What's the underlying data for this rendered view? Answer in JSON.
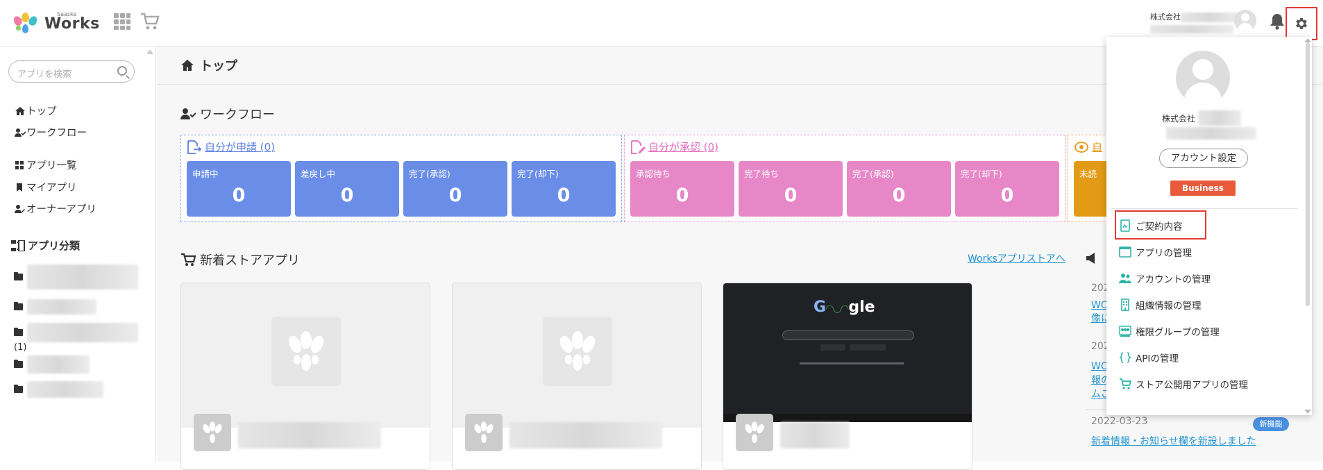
{
  "header": {
    "logo_small": "Saaske",
    "logo_text": "Works",
    "company_prefix": "株式会社"
  },
  "sidebar": {
    "search_placeholder": "アプリを検索",
    "nav": [
      {
        "label": "トップ",
        "icon": "home-icon"
      },
      {
        "label": "ワークフロー",
        "icon": "user-check-icon"
      },
      {
        "label": "アプリ一覧",
        "icon": "grid-icon"
      },
      {
        "label": "マイアプリ",
        "icon": "bookmark-icon"
      },
      {
        "label": "オーナーアプリ",
        "icon": "user-edit-icon"
      }
    ],
    "category_title": "アプリ分類",
    "category_count": "(1)"
  },
  "main": {
    "page_title": "トップ",
    "workflow_title": "ワークフロー",
    "groups": [
      {
        "link": "自分が申請 (0)",
        "color": "#6a8ee8",
        "cards": [
          {
            "label": "申請中",
            "value": "0"
          },
          {
            "label": "差戻し中",
            "value": "0"
          },
          {
            "label": "完了(承認)",
            "value": "0"
          },
          {
            "label": "完了(却下)",
            "value": "0"
          }
        ]
      },
      {
        "link": "自分が承認 (0)",
        "color": "#e887c8",
        "cards": [
          {
            "label": "承認待ち",
            "value": "0"
          },
          {
            "label": "完了待ち",
            "value": "0"
          },
          {
            "label": "完了(承認)",
            "value": "0"
          },
          {
            "label": "完了(却下)",
            "value": "0"
          }
        ]
      },
      {
        "link": "自",
        "color": "#e39a15",
        "cards": [
          {
            "label": "未読",
            "value": ""
          }
        ]
      }
    ],
    "store_title": "新着ストアアプリ",
    "store_link": "Worksアプリストアへ",
    "google_text": "gle",
    "news": [
      {
        "date": "202",
        "link_lines": [
          "WO",
          "像に"
        ]
      },
      {
        "date": "202",
        "link_lines": [
          "WO",
          "報の",
          "ムご"
        ]
      },
      {
        "date": "2022-03-23",
        "link_lines": [
          "新着情報・お知らせ欄を新設しました"
        ],
        "badge": "新機能"
      }
    ]
  },
  "dropdown": {
    "company_prefix": "株式会社",
    "account_button": "アカウント設定",
    "plan_badge": "Business",
    "items": [
      {
        "label": "ご契約内容",
        "icon": "contract-icon"
      },
      {
        "label": "アプリの管理",
        "icon": "window-icon"
      },
      {
        "label": "アカウントの管理",
        "icon": "users-icon"
      },
      {
        "label": "組織情報の管理",
        "icon": "building-icon"
      },
      {
        "label": "権限グループの管理",
        "icon": "group-icon"
      },
      {
        "label": "APIの管理",
        "icon": "braces-icon"
      },
      {
        "label": "ストア公開用アプリの管理",
        "icon": "cart-icon"
      }
    ],
    "accent": "#2bb3a8"
  }
}
